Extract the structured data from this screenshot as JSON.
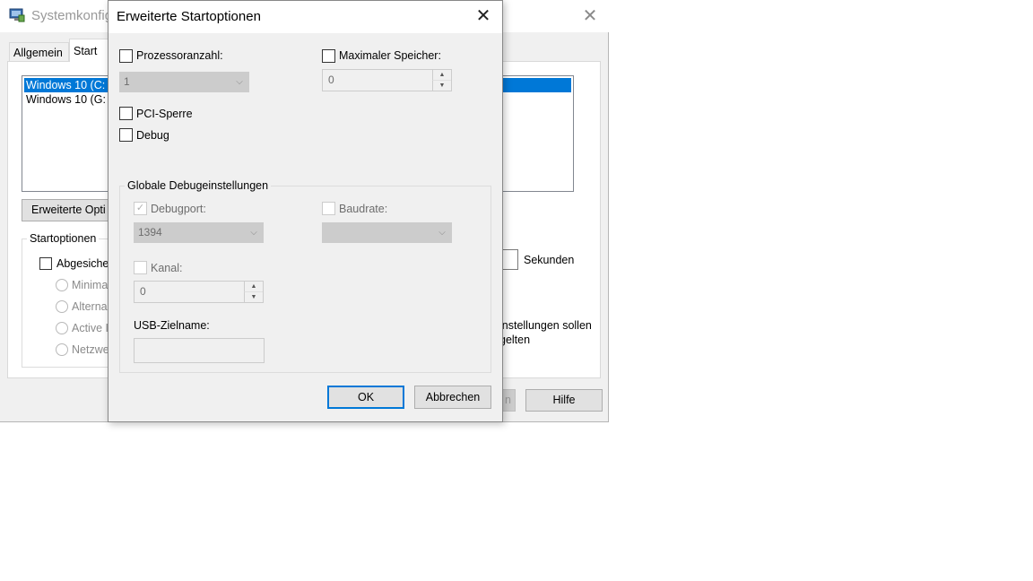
{
  "background_window": {
    "title": "Systemkonfig",
    "tabs": [
      "Allgemein",
      "Start"
    ],
    "os_list": [
      "Windows 10 (C:",
      "Windows 10 (G:"
    ],
    "advanced_button": "Erweiterte Opti",
    "start_options": {
      "group_label": "Startoptionen",
      "safe_boot_label": "Abgesiche",
      "radios": [
        "Minima",
        "Alterna",
        "Active I",
        "Netzwe"
      ]
    },
    "seconds_label": "Sekunden",
    "note": "instellungen sollen\ngelten",
    "apply_button": "n",
    "help_button": "Hilfe"
  },
  "dialog": {
    "title": "Erweiterte Startoptionen",
    "close_glyph": "✕",
    "processor_count": {
      "label": "Prozessoranzahl:",
      "checked": false,
      "value": "1"
    },
    "max_memory": {
      "label": "Maximaler Speicher:",
      "checked": false,
      "value": "0"
    },
    "pci_lock": {
      "label": "PCI-Sperre",
      "checked": false
    },
    "debug": {
      "label": "Debug",
      "checked": false
    },
    "debug_settings": {
      "group_label": "Globale Debugeinstellungen",
      "debug_port": {
        "label": "Debugport:",
        "checked": true,
        "value": "1394"
      },
      "baud_rate": {
        "label": "Baudrate:",
        "checked": false,
        "value": ""
      },
      "channel": {
        "label": "Kanal:",
        "checked": false,
        "value": "0"
      },
      "usb_target": {
        "label": "USB-Zielname:",
        "value": ""
      }
    },
    "ok_button": "OK",
    "cancel_button": "Abbrechen"
  },
  "colors": {
    "selection": "#0078d7",
    "window_bg": "#f0f0f0",
    "disabled_text": "#6d6d6d"
  }
}
